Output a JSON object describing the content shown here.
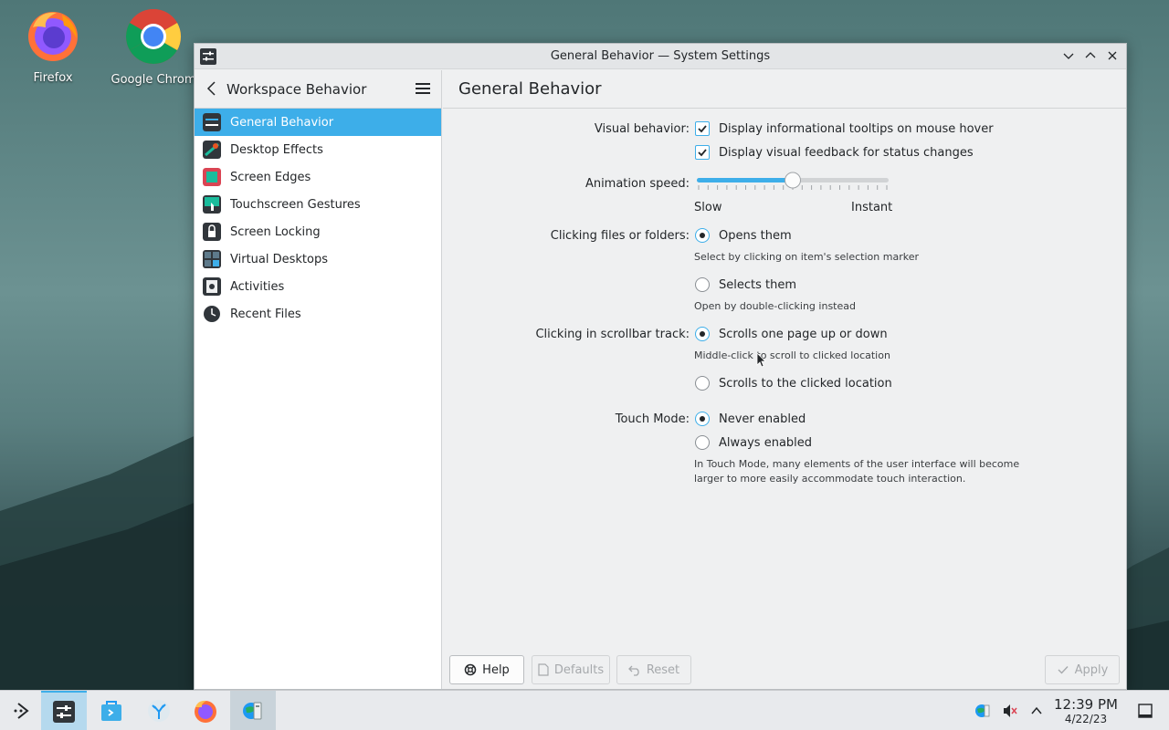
{
  "desktop": {
    "icons": [
      {
        "label": "Firefox",
        "icon": "firefox-icon"
      },
      {
        "label": "Google Chrom",
        "icon": "chrome-icon"
      }
    ]
  },
  "window": {
    "title": "General Behavior — System Settings",
    "controls": [
      "minimize-icon",
      "maximize-icon",
      "close-icon"
    ]
  },
  "sidebar": {
    "header": "Workspace Behavior",
    "items": [
      {
        "label": "General Behavior",
        "active": true
      },
      {
        "label": "Desktop Effects"
      },
      {
        "label": "Screen Edges"
      },
      {
        "label": "Touchscreen Gestures"
      },
      {
        "label": "Screen Locking"
      },
      {
        "label": "Virtual Desktops"
      },
      {
        "label": "Activities"
      },
      {
        "label": "Recent Files"
      }
    ]
  },
  "main": {
    "title": "General Behavior",
    "visual_behavior": {
      "label": "Visual behavior:",
      "opt1": "Display informational tooltips on mouse hover",
      "opt2": "Display visual feedback for status changes",
      "opt1_checked": true,
      "opt2_checked": true
    },
    "animation": {
      "label": "Animation speed:",
      "min_label": "Slow",
      "max_label": "Instant",
      "value_fraction": 0.5
    },
    "clicking_files": {
      "label": "Clicking files or folders:",
      "opt1": "Opens them",
      "hint1": "Select by clicking on item's selection marker",
      "opt2": "Selects them",
      "hint2": "Open by double-clicking instead",
      "selected": "Opens them"
    },
    "scrollbar": {
      "label": "Clicking in scrollbar track:",
      "opt1": "Scrolls one page up or down",
      "hint1": "Middle-click to scroll to clicked location",
      "opt2": "Scrolls to the clicked location",
      "selected": "Scrolls one page up or down"
    },
    "touch_mode": {
      "label": "Touch Mode:",
      "opt1": "Never enabled",
      "opt2": "Always enabled",
      "hint_line1": "In Touch Mode, many elements of the user interface will become",
      "hint_line2": "larger to more easily accommodate touch interaction.",
      "selected": "Never enabled"
    },
    "buttons": {
      "help": "Help",
      "defaults": "Defaults",
      "reset": "Reset",
      "apply": "Apply"
    }
  },
  "taskbar": {
    "clock_time": "12:39 PM",
    "clock_date": "4/22/23"
  }
}
